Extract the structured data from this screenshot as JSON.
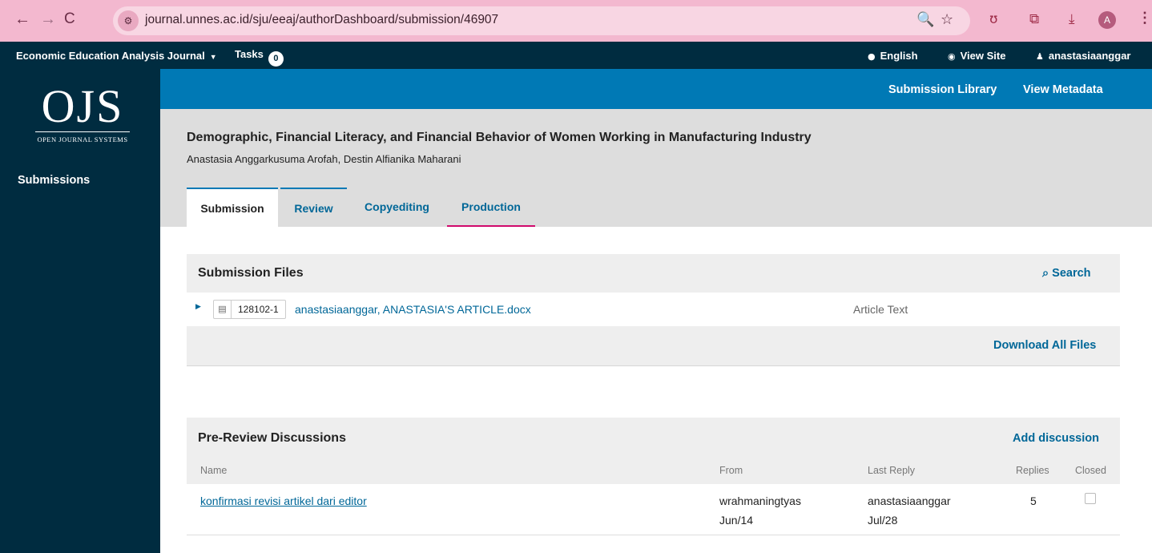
{
  "browser": {
    "back_icon": "←",
    "forward_icon": "→",
    "reload_icon": "C",
    "site_info_icon": "⚙",
    "url": "journal.unnes.ac.id/sju/eeaj/authorDashboard/submission/46907",
    "zoom_icon": "🔍",
    "bookmark_icon": "☆",
    "extension_icon": "ʊ",
    "puzzle_icon": "⧉",
    "download_icon": "⤓",
    "profile_initial": "A",
    "menu_icon": "⋮"
  },
  "topbar": {
    "journal_name": "Economic Education Analysis Journal",
    "tasks_label": "Tasks",
    "tasks_count": "0",
    "language": "English",
    "view_site": "View Site",
    "username": "anastasiaanggar"
  },
  "sidebar": {
    "logo_big": "OJS",
    "logo_small": "OPEN JOURNAL SYSTEMS",
    "submissions": "Submissions"
  },
  "header": {
    "submission_library": "Submission Library",
    "view_metadata": "View Metadata",
    "title": "Demographic, Financial Literacy, and Financial Behavior of Women Working in Manufacturing Industry",
    "authors": "Anastasia Anggarkusuma Arofah, Destin Alfianika Maharani",
    "tabs": [
      "Submission",
      "Review",
      "Copyediting",
      "Production"
    ]
  },
  "submission_files": {
    "title": "Submission Files",
    "search": "Search",
    "files": [
      {
        "id": "128102-1",
        "name": "anastasiaanggar, ANASTASIA'S ARTICLE.docx",
        "type": "Article Text"
      }
    ],
    "download_all": "Download All Files"
  },
  "discussions": {
    "title": "Pre-Review Discussions",
    "add": "Add discussion",
    "columns": {
      "name": "Name",
      "from": "From",
      "last_reply": "Last Reply",
      "replies": "Replies",
      "closed": "Closed"
    },
    "rows": [
      {
        "name": "konfirmasi revisi artikel dari editor",
        "from_user": "wrahmaningtyas",
        "from_date": "Jun/14",
        "reply_user": "anastasiaanggar",
        "reply_date": "Jul/28",
        "replies": "5",
        "closed": false
      }
    ]
  },
  "colors": {
    "chrome": "#f3b8cf",
    "ojs_dark": "#002c40",
    "ojs_blue": "#0079b5",
    "link": "#006798",
    "tab_accent": "#d00a6c"
  }
}
